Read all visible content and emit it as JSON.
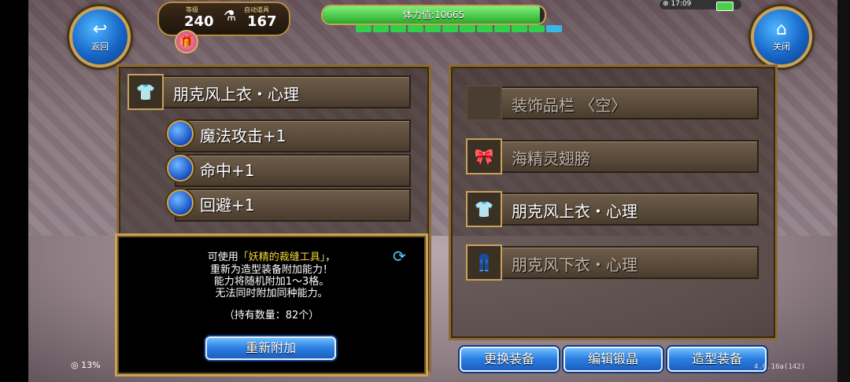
{
  "hud": {
    "back_label": "返回",
    "close_label": "关闭",
    "level_caption": "等级",
    "level_value": "240",
    "auto_caption": "自动道具",
    "auto_value": "167",
    "hp_text": "体力值:10665",
    "hp_fill_fraction": 0.98,
    "stamina_segments": [
      "#2fd04a",
      "#2fd04a",
      "#2fd04a",
      "#2fd04a",
      "#2fd04a",
      "#2fd04a",
      "#2fd04a",
      "#2fd04a",
      "#2fd04a",
      "#2fd04a",
      "#2fd04a",
      "#38b8e8"
    ],
    "clock": "17:09"
  },
  "left": {
    "item_name": "朋克风上衣・心理",
    "abilities": [
      {
        "label": "魔法攻击+1"
      },
      {
        "label": "命中+1"
      },
      {
        "label": "回避+1"
      }
    ]
  },
  "info": {
    "line1_prefix": "可使用",
    "line1_highlight": "「妖精的裁缝工具」",
    "line1_suffix": "，",
    "line2": "重新为造型装备附加能力！",
    "line3": "能力将随机附加1～3格。",
    "line4": "无法同时附加同种能力。",
    "count": "（持有数量：82个）",
    "reattach_label": "重新附加"
  },
  "right": {
    "slots": [
      {
        "label": "装饰品栏 〈空〉",
        "icon": "empty-slot",
        "dim": true
      },
      {
        "label": "海精灵翅膀",
        "icon": "ribbon-icon",
        "dim": true
      },
      {
        "label": "朋克风上衣・心理",
        "icon": "shirt-icon",
        "dim": false
      },
      {
        "label": "朋克风下衣・心理",
        "icon": "pants-icon",
        "dim": true
      }
    ]
  },
  "bottom": {
    "change_equip": "更换装备",
    "edit_crystal": "编辑锻晶",
    "style_equip": "造型装备",
    "version": "4.0.16a(142)",
    "percent": "13%"
  }
}
